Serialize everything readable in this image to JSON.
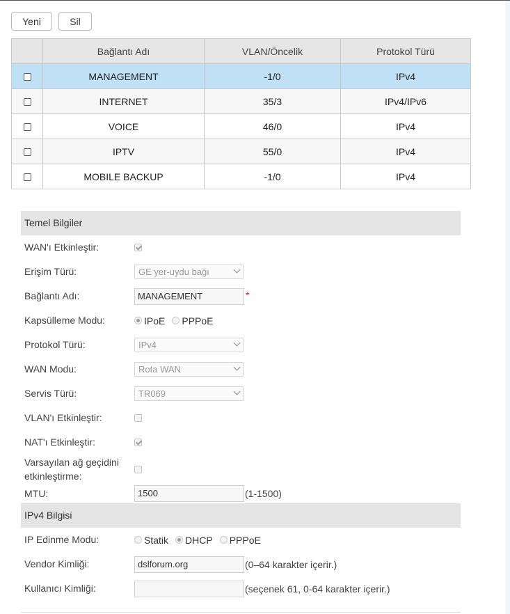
{
  "toolbar": {
    "new_label": "Yeni",
    "delete_label": "Sil"
  },
  "table": {
    "headers": [
      "",
      "Bağlantı Adı",
      "VLAN/Öncelik",
      "Protokol Türü"
    ],
    "rows": [
      {
        "name": "MANAGEMENT",
        "vlan": "-1/0",
        "protocol": "IPv4",
        "selected": true
      },
      {
        "name": "INTERNET",
        "vlan": "35/3",
        "protocol": "IPv4/IPv6",
        "selected": false
      },
      {
        "name": "VOICE",
        "vlan": "46/0",
        "protocol": "IPv4",
        "selected": false
      },
      {
        "name": "IPTV",
        "vlan": "55/0",
        "protocol": "IPv4",
        "selected": false
      },
      {
        "name": "MOBILE BACKUP",
        "vlan": "-1/0",
        "protocol": "IPv4",
        "selected": false
      }
    ]
  },
  "basic": {
    "title": "Temel Bilgiler",
    "wan_enable_label": "WAN'ı Etkinleştir:",
    "wan_enable_checked": true,
    "access_type_label": "Erişim Türü:",
    "access_type_value": "GE yer-uydu bağı",
    "conn_name_label": "Bağlantı Adı:",
    "conn_name_value": "MANAGEMENT",
    "required_mark": "*",
    "encap_label": "Kapsülleme Modu:",
    "encap_options": [
      "IPoE",
      "PPPoE"
    ],
    "encap_selected": "IPoE",
    "protocol_label": "Protokol Türü:",
    "protocol_value": "IPv4",
    "wan_mode_label": "WAN Modu:",
    "wan_mode_value": "Rota WAN",
    "service_label": "Servis Türü:",
    "service_value": "TR069",
    "vlan_enable_label": "VLAN'ı Etkinleştir:",
    "vlan_enable_checked": false,
    "nat_enable_label": "NAT'ı Etkinleştir:",
    "nat_enable_checked": true,
    "default_gw_label_1": "Varsayılan ağ geçidini",
    "default_gw_label_2": "etkinleştirme:",
    "default_gw_checked": false,
    "mtu_label": "MTU:",
    "mtu_value": "1500",
    "mtu_hint": "(1-1500)"
  },
  "ipv4": {
    "title": "IPv4 Bilgisi",
    "ip_mode_label": "IP Edinme Modu:",
    "ip_mode_options": [
      "Statik",
      "DHCP",
      "PPPoE"
    ],
    "ip_mode_selected": "DHCP",
    "vendor_label": "Vendor Kimliği:",
    "vendor_value": "dslforum.org",
    "vendor_hint": "(0–64 karakter içerir.)",
    "user_label": "Kullanıcı Kimliği:",
    "user_value": "",
    "user_hint": "(seçenek 61, 0-64 karakter içerir.)"
  }
}
